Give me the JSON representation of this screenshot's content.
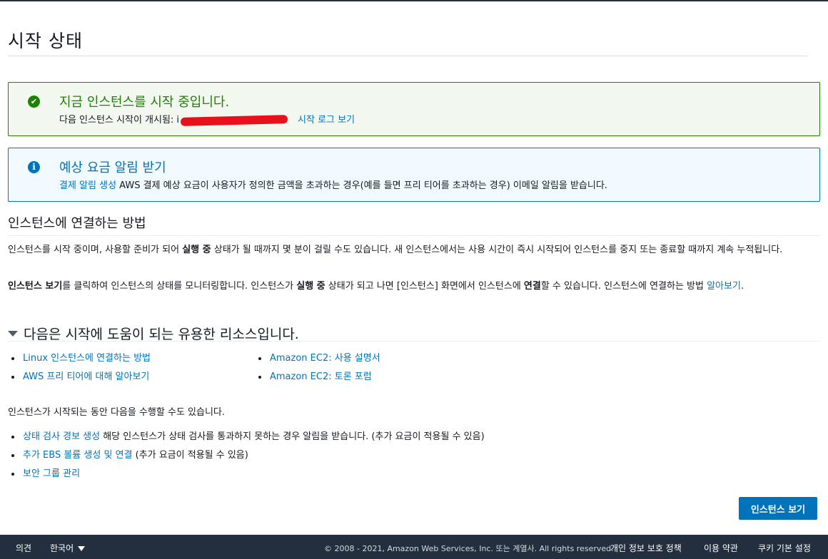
{
  "page": {
    "title": "시작 상태"
  },
  "success_alert": {
    "icon": "check-circle-icon",
    "title": "지금 인스턴스를 시작 중입니다.",
    "text": "다음 인스턴스 시작이 개시됨: i",
    "link": "시작 로그 보기",
    "color": "#1d8102"
  },
  "info_alert": {
    "icon": "info-circle-icon",
    "title": "예상 요금 알림 받기",
    "link": "결제 알림 생성",
    "text": "AWS 결제 예상 요금이 사용자가 정의한 금액을 초과하는 경우(예를 들면 프리 티어를 초과하는 경우) 이메일 알림을 받습니다.",
    "color": "#0073bb"
  },
  "connect_section": {
    "heading": "인스턴스에 연결하는 방법",
    "para1_a": "인스턴스를 시작 중이며, 사용할 준비가 되어 ",
    "para1_b": "실행 중",
    "para1_c": " 상태가 될 때까지 몇 분이 걸릴 수도 있습니다. 새 인스턴스에서는 사용 시간이 즉시 시작되어 인스턴스를 중지 또는 종료할 때까지 계속 누적됩니다.",
    "para2_a": "인스턴스 보기",
    "para2_b": "를 클릭하여 인스턴스의 상태를 모니터링합니다. 인스턴스가 ",
    "para2_c": "실행 중",
    "para2_d": " 상태가 되고 나면 [인스턴스] 화면에서 인스턴스에 ",
    "para2_e": "연결",
    "para2_f": "할 수 있습니다. 인스턴스에 연결하는 방법 ",
    "para2_link": "알아보기",
    "para2_end": "."
  },
  "resources": {
    "heading": "다음은 시작에 도움이 되는 유용한 리소스입니다.",
    "left": [
      "Linux 인스턴스에 연결하는 방법",
      "AWS 프리 티어에 대해 알아보기"
    ],
    "right": [
      "Amazon EC2: 사용 설명서",
      "Amazon EC2: 토론 포럼"
    ]
  },
  "actions": {
    "intro": "인스턴스가 시작되는 동안 다음을 수행할 수도 있습니다.",
    "items": [
      {
        "link": "상태 검사 경보 생성",
        "text": " 해당 인스턴스가 상태 검사를 통과하지 못하는 경우 알림을 받습니다. (추가 요금이 적용될 수 있음)"
      },
      {
        "link": "추가 EBS 볼륨 생성 및 연결",
        "text": " (추가 요금이 적용될 수 있음)"
      },
      {
        "link": "보안 그룹 관리",
        "text": ""
      }
    ]
  },
  "primary_button": {
    "label": "인스턴스 보기"
  },
  "footer": {
    "feedback": "의견",
    "language": "한국어",
    "copyright": "© 2008 - 2021, Amazon Web Services, Inc. 또는 계열사. All rights reserved.",
    "privacy": "개인 정보 보호 정책",
    "terms": "이용 약관",
    "cookies": "쿠키 기본 설정"
  }
}
